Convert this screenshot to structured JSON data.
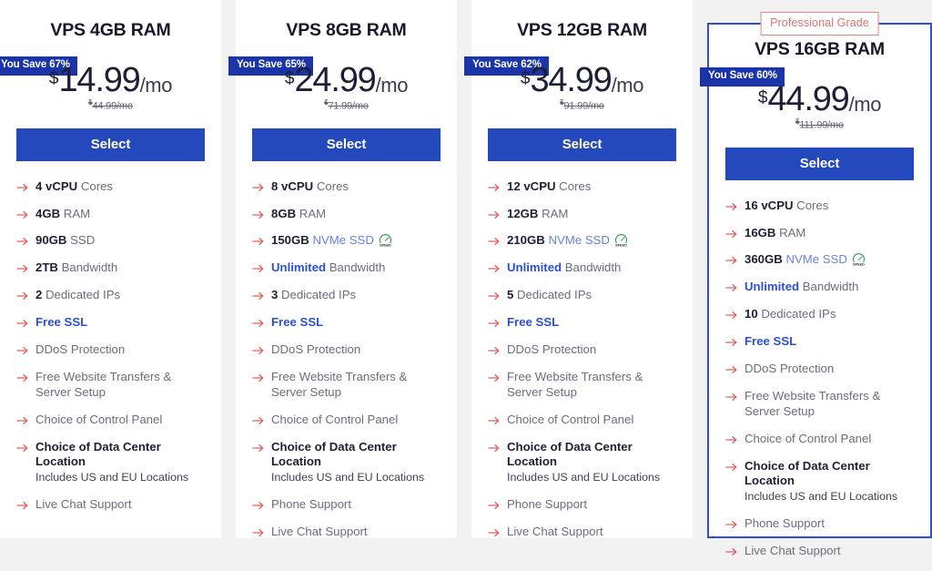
{
  "theme": {
    "button_blue": "#2449bd",
    "badge_navy": "#1b35a8",
    "featured_border": "#2f4fce",
    "ribbon_salmon": "#e0736f",
    "arrow_red": "#e0605c",
    "link_blue": "#2b4fd6",
    "page_bg": "#f2f2f2"
  },
  "icons": {
    "arrow": "arrow-right-icon",
    "speed": "speed-badge-icon",
    "speed_label": "SPEED"
  },
  "plans": [
    {
      "id": "vps-4gb",
      "title": "VPS 4GB RAM",
      "save_badge": "You Save 67%",
      "currency": "$",
      "price": "14.99",
      "period": "/mo",
      "old_price": "44.99/mo",
      "old_currency": "$",
      "select_label": "Select",
      "featured": false,
      "ribbon": "",
      "features": [
        {
          "strong": "4 vCPU",
          "text": " Cores"
        },
        {
          "strong": "4GB",
          "text": " RAM"
        },
        {
          "strong": "90GB",
          "text": " SSD"
        },
        {
          "strong": "2TB",
          "text": " Bandwidth"
        },
        {
          "strong": "2",
          "text": " Dedicated IPs"
        },
        {
          "highlight": "Free SSL"
        },
        {
          "text": "DDoS Protection"
        },
        {
          "text": "Free Website Transfers & Server Setup"
        },
        {
          "text": "Choice of Control Panel"
        },
        {
          "bold_row": true,
          "text": "Choice of Data Center Location",
          "note": "Includes US and EU Locations"
        },
        {
          "text": "Live Chat Support"
        }
      ]
    },
    {
      "id": "vps-8gb",
      "title": "VPS 8GB RAM",
      "save_badge": "You Save 65%",
      "currency": "$",
      "price": "24.99",
      "period": "/mo",
      "old_price": "71.99/mo",
      "old_currency": "$",
      "select_label": "Select",
      "featured": false,
      "ribbon": "",
      "features": [
        {
          "strong": "8 vCPU",
          "text": " Cores"
        },
        {
          "strong": "8GB",
          "text": " RAM"
        },
        {
          "strong": "150GB",
          "soft": " NVMe SSD",
          "speed": true
        },
        {
          "highlight": "Unlimited",
          "text": " Bandwidth"
        },
        {
          "strong": "3",
          "text": " Dedicated IPs"
        },
        {
          "highlight": "Free SSL"
        },
        {
          "text": "DDoS Protection"
        },
        {
          "text": "Free Website Transfers & Server Setup"
        },
        {
          "text": "Choice of Control Panel"
        },
        {
          "bold_row": true,
          "text": "Choice of Data Center Location",
          "note": "Includes US and EU Locations"
        },
        {
          "text": "Phone Support"
        },
        {
          "text": "Live Chat Support"
        }
      ]
    },
    {
      "id": "vps-12gb",
      "title": "VPS 12GB RAM",
      "save_badge": "You Save 62%",
      "currency": "$",
      "price": "34.99",
      "period": "/mo",
      "old_price": "91.99/mo",
      "old_currency": "$",
      "select_label": "Select",
      "featured": false,
      "ribbon": "",
      "features": [
        {
          "strong": "12 vCPU",
          "text": " Cores"
        },
        {
          "strong": "12GB",
          "text": " RAM"
        },
        {
          "strong": "210GB",
          "soft": " NVMe SSD",
          "speed": true
        },
        {
          "highlight": "Unlimited",
          "text": " Bandwidth"
        },
        {
          "strong": "5",
          "text": " Dedicated IPs"
        },
        {
          "highlight": "Free SSL"
        },
        {
          "text": "DDoS Protection"
        },
        {
          "text": "Free Website Transfers & Server Setup"
        },
        {
          "text": "Choice of Control Panel"
        },
        {
          "bold_row": true,
          "text": "Choice of Data Center Location",
          "note": "Includes US and EU Locations"
        },
        {
          "text": "Phone Support"
        },
        {
          "text": "Live Chat Support"
        }
      ]
    },
    {
      "id": "vps-16gb",
      "title": "VPS 16GB RAM",
      "save_badge": "You Save 60%",
      "currency": "$",
      "price": "44.99",
      "period": "/mo",
      "old_price": "111.99/mo",
      "old_currency": "$",
      "select_label": "Select",
      "featured": true,
      "ribbon": "Professional Grade",
      "features": [
        {
          "strong": "16 vCPU",
          "text": " Cores"
        },
        {
          "strong": "16GB",
          "text": " RAM"
        },
        {
          "strong": "360GB",
          "soft": " NVMe SSD",
          "speed": true
        },
        {
          "highlight": "Unlimited",
          "text": " Bandwidth"
        },
        {
          "strong": "10",
          "text": " Dedicated IPs"
        },
        {
          "highlight": "Free SSL"
        },
        {
          "text": "DDoS Protection"
        },
        {
          "text": "Free Website Transfers & Server Setup"
        },
        {
          "text": "Choice of Control Panel"
        },
        {
          "bold_row": true,
          "text": "Choice of Data Center Location",
          "note": "Includes US and EU Locations"
        },
        {
          "text": "Phone Support"
        },
        {
          "text": "Live Chat Support"
        }
      ]
    }
  ]
}
